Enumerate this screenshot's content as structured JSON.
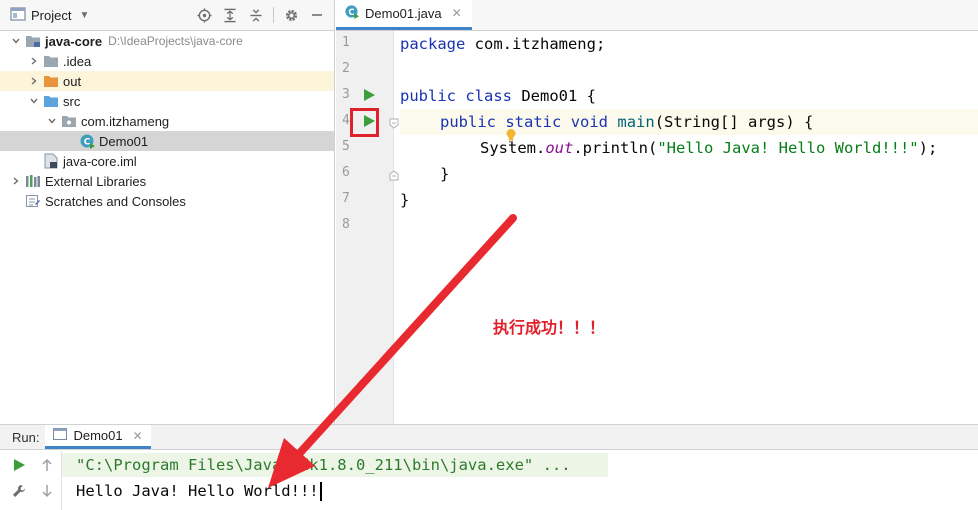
{
  "project_panel": {
    "title": "Project",
    "tree": [
      {
        "label": "java-core",
        "hint": "D:\\IdeaProjects\\java-core"
      },
      {
        "label": ".idea"
      },
      {
        "label": "out"
      },
      {
        "label": "src"
      },
      {
        "label": "com.itzhameng"
      },
      {
        "label": "Demo01"
      },
      {
        "label": "java-core.iml"
      },
      {
        "label": "External Libraries"
      },
      {
        "label": "Scratches and Consoles"
      }
    ]
  },
  "editor": {
    "tab_label": "Demo01.java",
    "line_numbers": [
      "1",
      "2",
      "3",
      "4",
      "5",
      "6",
      "7",
      "8"
    ],
    "code": {
      "l1_kw": "package",
      "l1_rest": " com.itzhameng;",
      "l3_kw1": "public",
      "l3_kw2": "class",
      "l3_rest": " Demo01 {",
      "l4_kw1": "public",
      "l4_kw2": "static",
      "l4_kw3": "void",
      "l4_fn": "main",
      "l4_rest": "(String[] args) {",
      "l5_a": "System.",
      "l5_field": "out",
      "l5_b": ".println(",
      "l5_str": "\"Hello Java! Hello World!!!\"",
      "l5_c": ");",
      "l6": "}",
      "l7": "}"
    }
  },
  "annotation_text": "执行成功！！！",
  "run_panel": {
    "label": "Run:",
    "tab_label": "Demo01",
    "console": [
      "\"C:\\Program Files\\Java\\jdk1.8.0_211\\bin\\java.exe\" ...",
      "Hello Java! Hello World!!!"
    ]
  },
  "colors": {
    "run_green": "#3b9e3b",
    "highlight_red": "#e0202a",
    "keyword_blue": "#1a33b3",
    "string_green": "#067d17",
    "accent_blue": "#4083c9"
  }
}
